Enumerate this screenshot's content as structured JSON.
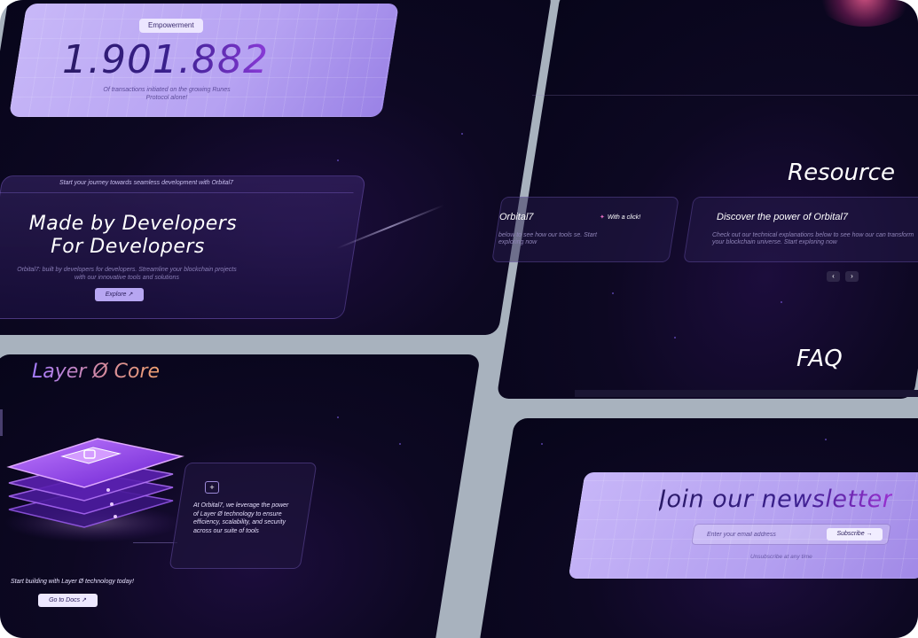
{
  "stat": {
    "badge": "Empowerment",
    "number": "1.901.882",
    "caption": "Of transactions initiated on the growing Runes Protocol alone!"
  },
  "hero": {
    "kicker": "Start your journey towards seamless development with Orbital7",
    "title_line1": "Made by Developers",
    "title_line2": "For Developers",
    "subtitle": "Orbital7: built by developers for developers. Streamline your blockchain projects with our innovative tools and solutions",
    "explore_label": "Explore ↗"
  },
  "resources": {
    "title": "Resource",
    "card1_title": "Orbital7",
    "card1_text": "below to see how our tools se. Start exploring now",
    "click_badge": "With a click!",
    "card2_title": "Discover the power of Orbital7",
    "card2_text": "Check out our technical explanations below to see how our can transform your blockchain universe. Start exploring now",
    "prev_label": "‹",
    "next_label": "›"
  },
  "faq": {
    "title": "FAQ"
  },
  "layer": {
    "title": "Layer Ø Core",
    "plus_label": "+",
    "info_text": "At Orbital7, we leverage the power of Layer Ø technology to ensure efficiency, scalability, and security across our suite of tools",
    "caption": "Start building with Layer Ø technology today!",
    "docs_label": "Go to Docs ↗"
  },
  "newsletter": {
    "title": "Join our newsletter",
    "email_placeholder": "Enter your email address",
    "subscribe_label": "Subscribe →",
    "unsubscribe": "Unsubscribe at any time"
  },
  "colors": {
    "frame_gray": "#a8b2be",
    "panel_dark": "#0d0822",
    "lavender": "#b7a6f2",
    "accent_orange": "#f0a070"
  }
}
